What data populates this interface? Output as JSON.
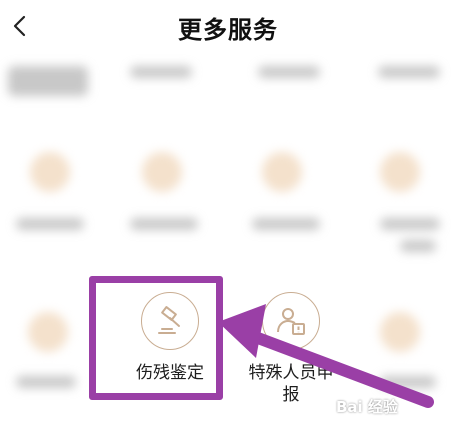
{
  "header": {
    "title": "更多服务"
  },
  "icons": {
    "back": "chevron-left-icon",
    "gavel": "gavel-icon",
    "person_alert": "person-alert-icon"
  },
  "services": [
    {
      "label_line1": "伤残鉴定",
      "label_line2": ""
    },
    {
      "label_line1": "特殊人员申",
      "label_line2": "报"
    }
  ],
  "colors": {
    "accent_brown": "#c9ad92",
    "highlight_purple": "#9a3fa6"
  }
}
